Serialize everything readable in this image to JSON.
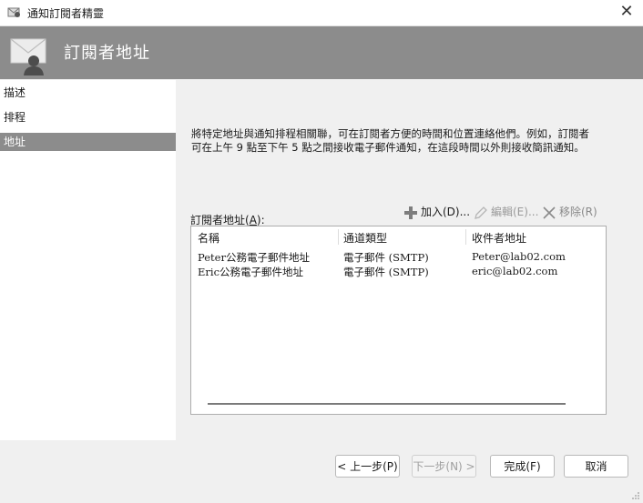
{
  "window": {
    "title": "通知訂閱者精靈",
    "close_icon": "close-icon"
  },
  "banner": {
    "heading": "訂閱者地址"
  },
  "sidebar": {
    "items": [
      {
        "label": "描述",
        "active": false
      },
      {
        "label": "排程",
        "active": false
      },
      {
        "label": "地址",
        "active": true
      }
    ]
  },
  "main": {
    "description": "將特定地址與通知排程相關聯，可在訂閱者方便的時間和位置連絡他們。例如，訂閱者可在上午 9 點至下午 5 點之間接收電子郵件通知，在這段時間以外則接收簡訊通知。",
    "list_label_prefix": "訂閱者地址(",
    "list_label_key": "A",
    "list_label_suffix": "):",
    "toolbar": {
      "add": "加入(D)...",
      "edit": "編輯(E)...",
      "remove": "移除(R)"
    },
    "columns": [
      "名稱",
      "通道類型",
      "收件者地址"
    ],
    "rows": [
      [
        "Peter公務電子郵件地址",
        "電子郵件 (SMTP)",
        "Peter@lab02.com"
      ],
      [
        "Eric公務電子郵件地址",
        "電子郵件 (SMTP)",
        "eric@lab02.com"
      ]
    ]
  },
  "footer": {
    "back": "< 上一步(P)",
    "next": "下一步(N) >",
    "finish": "完成(F)",
    "cancel": "取消"
  },
  "colors": {
    "banner": "#8c8c8c",
    "sidebar_active": "#8c8c8c",
    "add_icon": "#7d7d7d"
  }
}
